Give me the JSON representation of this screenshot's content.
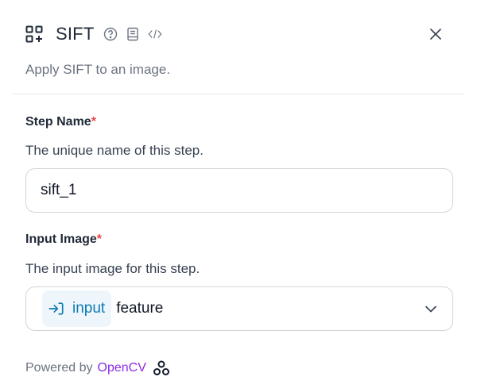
{
  "header": {
    "title": "SIFT",
    "description": "Apply SIFT to an image."
  },
  "fields": {
    "step_name": {
      "label": "Step Name",
      "required_mark": "*",
      "help": "The unique name of this step.",
      "value": "sift_1"
    },
    "input_image": {
      "label": "Input Image",
      "required_mark": "*",
      "help": "The input image for this step.",
      "chip_label": "input",
      "value": "feature"
    }
  },
  "footer": {
    "powered_by": "Powered by",
    "brand": "OpenCV"
  },
  "icons": {
    "block": "block-icon",
    "help": "help-icon",
    "docs": "book-icon",
    "code": "code-icon",
    "close": "close-icon",
    "chip": "input-arrow-icon",
    "chevron": "chevron-down-icon",
    "brand": "opencv-logo-icon"
  },
  "colors": {
    "accent": "#0e7bb3",
    "chip_bg": "#eef6fb",
    "required": "#ef4444",
    "brand": "#8b2be2"
  }
}
